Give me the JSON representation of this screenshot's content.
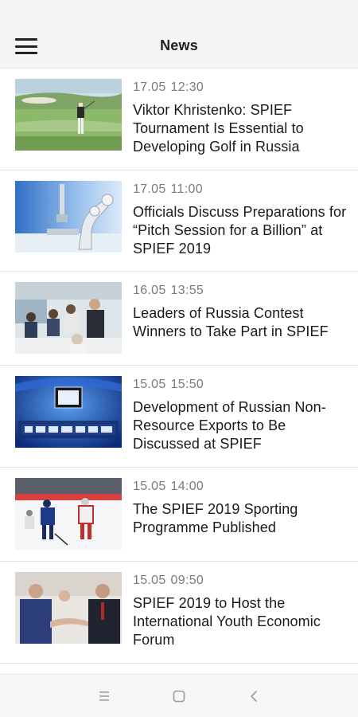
{
  "app_bar": {
    "title": "News",
    "menu_icon": "hamburger-menu-icon"
  },
  "news": [
    {
      "date": "17.05",
      "time": "12:30",
      "title": "Viktor Khristenko: SPIEF Tournament Is Essential to Developing Golf in Russia",
      "thumb": "golf"
    },
    {
      "date": "17.05",
      "time": "11:00",
      "title": "Officials Discuss Preparations for “Pitch Session for a Billion” at SPIEF 2019",
      "thumb": "robot-arm"
    },
    {
      "date": "16.05",
      "time": "13:55",
      "title": "Leaders of Russia Contest Winners to Take Part in SPIEF",
      "thumb": "conference"
    },
    {
      "date": "15.05",
      "time": "15:50",
      "title": "Development of Russian Non-Resource Exports to Be Discussed at SPIEF",
      "thumb": "tv-studio"
    },
    {
      "date": "15.05",
      "time": "14:00",
      "title": "The SPIEF 2019 Sporting Programme Published",
      "thumb": "hockey"
    },
    {
      "date": "15.05",
      "time": "09:50",
      "title": "SPIEF 2019 to Host the International Youth Economic Forum",
      "thumb": "handshake"
    }
  ],
  "system_nav": {
    "recents_icon": "recents-icon",
    "home_icon": "home-icon",
    "back_icon": "back-icon"
  },
  "colors": {
    "app_bar_bg": "#f5f5f5",
    "meta_text": "#7a7a7a",
    "headline_text": "#1a1a1a",
    "divider": "#e4e4e4"
  }
}
